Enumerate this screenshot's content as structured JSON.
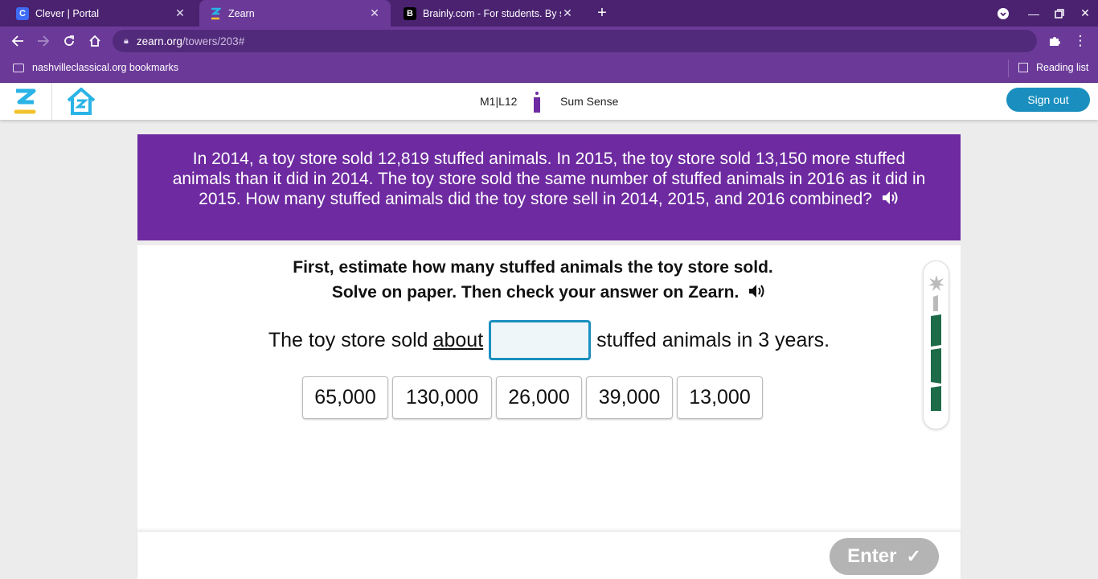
{
  "browser": {
    "tabs": [
      {
        "title": "Clever | Portal",
        "favicon": "C",
        "favicon_color": "#3d6bf5"
      },
      {
        "title": "Zearn",
        "favicon": "Z",
        "favicon_color": "#f2c12e"
      },
      {
        "title": "Brainly.com - For students. By st",
        "favicon": "B",
        "favicon_color": "#000000"
      }
    ],
    "url_host": "zearn.org",
    "url_path": "/towers/203#",
    "bookmark_folder": "nashvilleclassical.org bookmarks",
    "reading_list": "Reading list"
  },
  "header": {
    "lesson_code": "M1|L12",
    "lesson_title": "Sum Sense",
    "sign_out": "Sign out"
  },
  "problem": {
    "text": "In 2014, a toy store sold 12,819 stuffed animals. In 2015, the toy store sold 13,150 more stuffed animals than it did in 2014. The toy store sold the same number of stuffed animals in 2016 as it did in 2015. How many stuffed animals did the toy store sell in 2014, 2015, and 2016 combined?"
  },
  "instructions": {
    "line1": "First, estimate how many stuffed animals the toy store sold.",
    "line2": "Solve on paper. Then check your answer on Zearn."
  },
  "sentence": {
    "before": "The toy store sold",
    "about": "about",
    "after": "stuffed animals in 3 years."
  },
  "choices": [
    "65,000",
    "130,000",
    "26,000",
    "39,000",
    "13,000"
  ],
  "footer": {
    "enter_label": "Enter"
  },
  "colors": {
    "brand_purple": "#6e2aa0",
    "accent_blue": "#1a8fbf",
    "tower_green": "#1e6b4a"
  }
}
